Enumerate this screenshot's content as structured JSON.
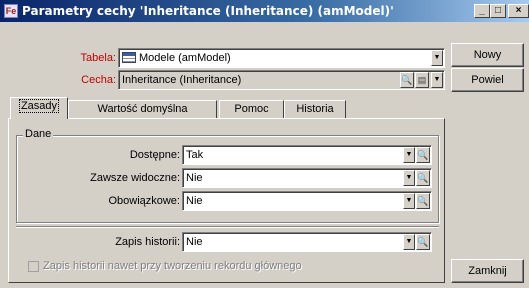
{
  "window": {
    "title": "Parametry cechy 'Inheritance (Inheritance) (amModel)'",
    "app_icon": "Fe",
    "controls": {
      "minimize": "_",
      "maximize": "□",
      "close": "×"
    }
  },
  "form": {
    "tabela_label": "Tabela:",
    "tabela_value": "Modele (amModel)",
    "cecha_label": "Cecha:",
    "cecha_value": "Inheritance (Inheritance)"
  },
  "buttons": {
    "nowy": "Nowy",
    "powiel": "Powiel",
    "zamknij": "Zamknij"
  },
  "tabs": [
    {
      "label": "Zasady",
      "active": true
    },
    {
      "label": "Wartość domyślna",
      "active": false
    },
    {
      "label": "Pomoc",
      "active": false
    },
    {
      "label": "Historia",
      "active": false
    }
  ],
  "group": {
    "label": "Dane",
    "fields": [
      {
        "label": "Dostępne:",
        "value": "Tak"
      },
      {
        "label": "Zawsze widoczne:",
        "value": "Nie"
      },
      {
        "label": "Obowiązkowe:",
        "value": "Nie"
      }
    ]
  },
  "history": {
    "label": "Zapis historii:",
    "value": "Nie",
    "checkbox_label": "Zapis historii nawet przy tworzeniu rekordu głównego",
    "checkbox_checked": false
  },
  "icons": {
    "dropdown": "▼",
    "zoom": "🔍"
  }
}
